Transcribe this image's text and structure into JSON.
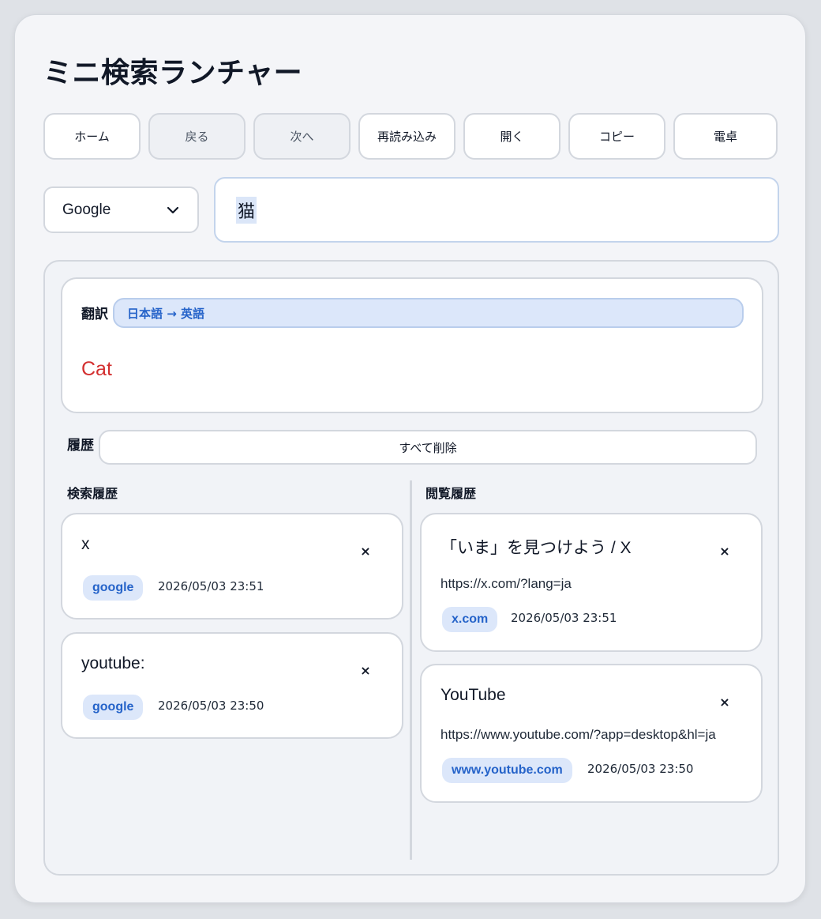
{
  "app": {
    "title": "ミニ検索ランチャー"
  },
  "toolbar": {
    "home": "ホーム",
    "back": "戻る",
    "forward": "次へ",
    "reload": "再読み込み",
    "open": "開く",
    "copy": "コピー",
    "calculator": "電卓"
  },
  "search": {
    "engine": "Google",
    "query": "猫"
  },
  "translation": {
    "label": "翻訳",
    "direction": "日本語 → 英語",
    "result": "Cat"
  },
  "history": {
    "label": "履歴",
    "clear_all": "すべて削除",
    "search_heading": "検索履歴",
    "browse_heading": "閲覧履歴",
    "search_items": [
      {
        "query": "x",
        "engine": "google",
        "time": "2026/05/03 23:51"
      },
      {
        "query": "youtube:",
        "engine": "google",
        "time": "2026/05/03 23:50"
      }
    ],
    "browse_items": [
      {
        "title": "「いま」を見つけよう / X",
        "url": "https://x.com/?lang=ja",
        "domain": "x.com",
        "time": "2026/05/03 23:51"
      },
      {
        "title": "YouTube",
        "url": "https://www.youtube.com/?app=desktop&hl=ja",
        "domain": "www.youtube.com",
        "time": "2026/05/03 23:50"
      }
    ],
    "delete_symbol": "×"
  }
}
